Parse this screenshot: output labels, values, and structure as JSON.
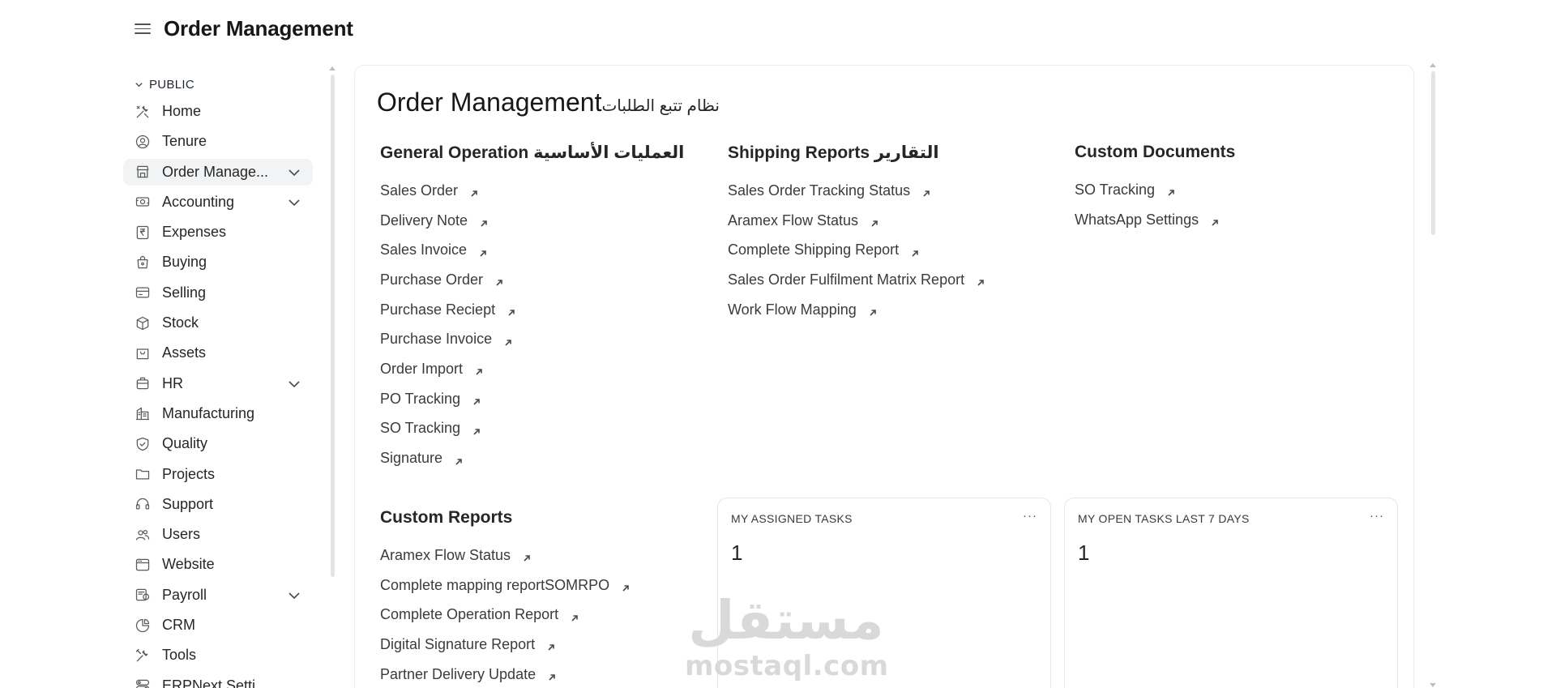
{
  "header": {
    "title": "Order Management"
  },
  "sidebar": {
    "section_label": "PUBLIC",
    "items": [
      {
        "label": "Home",
        "icon": "tools-icon",
        "expandable": false,
        "active": false
      },
      {
        "label": "Tenure",
        "icon": "user-circle-icon",
        "expandable": false,
        "active": false
      },
      {
        "label": "Order Manage...",
        "icon": "store-icon",
        "expandable": true,
        "active": true
      },
      {
        "label": "Accounting",
        "icon": "money-icon",
        "expandable": true,
        "active": false
      },
      {
        "label": "Expenses",
        "icon": "rupee-icon",
        "expandable": false,
        "active": false
      },
      {
        "label": "Buying",
        "icon": "bag-icon",
        "expandable": false,
        "active": false
      },
      {
        "label": "Selling",
        "icon": "card-icon",
        "expandable": false,
        "active": false
      },
      {
        "label": "Stock",
        "icon": "box-icon",
        "expandable": false,
        "active": false
      },
      {
        "label": "Assets",
        "icon": "basket-icon",
        "expandable": false,
        "active": false
      },
      {
        "label": "HR",
        "icon": "briefcase-icon",
        "expandable": true,
        "active": false
      },
      {
        "label": "Manufacturing",
        "icon": "building-icon",
        "expandable": false,
        "active": false
      },
      {
        "label": "Quality",
        "icon": "shield-icon",
        "expandable": false,
        "active": false
      },
      {
        "label": "Projects",
        "icon": "folder-icon",
        "expandable": false,
        "active": false
      },
      {
        "label": "Support",
        "icon": "headset-icon",
        "expandable": false,
        "active": false
      },
      {
        "label": "Users",
        "icon": "users-icon",
        "expandable": false,
        "active": false
      },
      {
        "label": "Website",
        "icon": "browser-icon",
        "expandable": false,
        "active": false
      },
      {
        "label": "Payroll",
        "icon": "payroll-icon",
        "expandable": true,
        "active": false
      },
      {
        "label": "CRM",
        "icon": "pie-chart-icon",
        "expandable": false,
        "active": false
      },
      {
        "label": "Tools",
        "icon": "wrench-icon",
        "expandable": false,
        "active": false
      },
      {
        "label": "ERPNext Settings",
        "icon": "settings-icon",
        "expandable": false,
        "active": false
      }
    ]
  },
  "workspace": {
    "title": "Order Management",
    "title_ar": "نظام تتبع الطلبات",
    "cards": [
      {
        "title": "General Operation العمليات الأساسية",
        "links": [
          "Sales Order",
          "Delivery Note",
          "Sales Invoice",
          "Purchase Order",
          "Purchase Reciept",
          "Purchase Invoice",
          "Order Import",
          "PO Tracking",
          "SO Tracking",
          "Signature"
        ]
      },
      {
        "title": "Shipping Reports التقارير",
        "links": [
          "Sales Order Tracking Status",
          "Aramex Flow Status",
          "Complete Shipping Report",
          "Sales Order Fulfilment Matrix Report",
          "Work Flow Mapping"
        ]
      },
      {
        "title": "Custom Documents",
        "links": [
          "SO Tracking",
          "WhatsApp Settings"
        ]
      },
      {
        "title": "Custom Reports",
        "links": [
          "Aramex Flow Status",
          "Complete mapping reportSOMRPO",
          "Complete Operation Report",
          "Digital Signature Report",
          "Partner Delivery Update"
        ]
      }
    ],
    "number_cards": [
      {
        "title": "MY ASSIGNED TASKS",
        "value": "1",
        "menu": "···"
      },
      {
        "title": "MY OPEN TASKS LAST 7 DAYS",
        "value": "1",
        "menu": "···"
      }
    ]
  },
  "watermark": {
    "text_ar": "مستقل",
    "text_en": "mostaql.com"
  }
}
